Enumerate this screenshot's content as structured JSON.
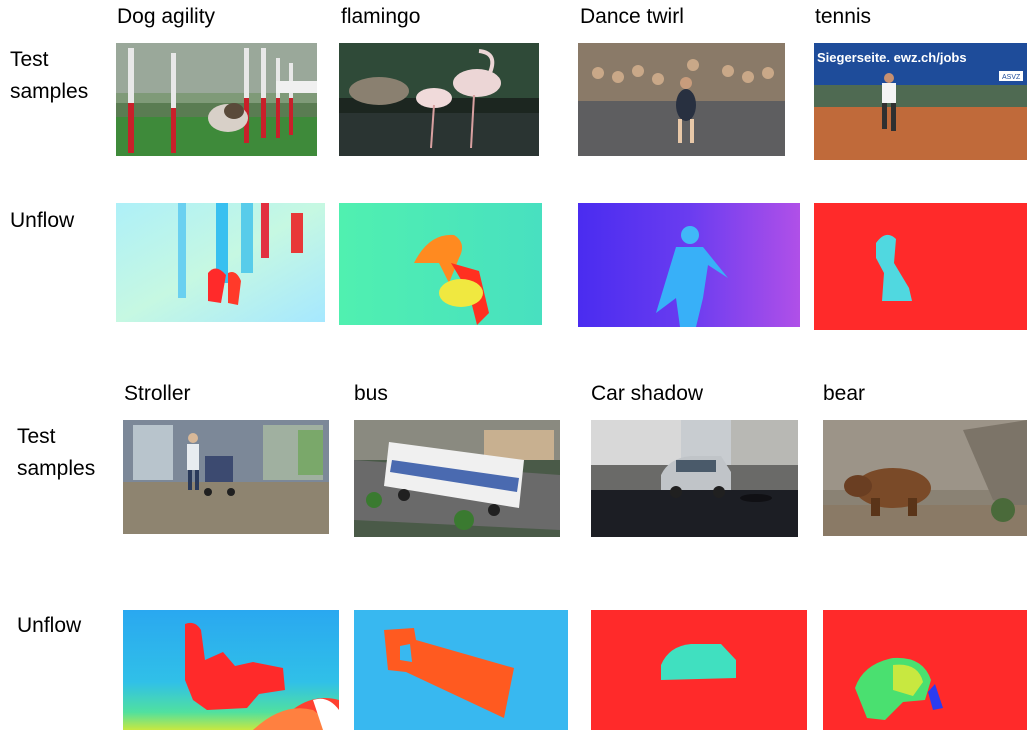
{
  "section1": {
    "titles": [
      "Dog agility",
      "flamingo",
      "Dance twirl",
      "tennis"
    ],
    "row_label_test": [
      "Test",
      "samples"
    ],
    "row_label_flow": "Unflow",
    "overlay_text": {
      "tennis_banner": "Siegerseite. ewz.ch/jobs",
      "tennis_badge": "ASVZ"
    }
  },
  "section2": {
    "titles": [
      "Stroller",
      "bus",
      "Car shadow",
      "bear"
    ],
    "row_label_test": [
      "Test",
      "samples"
    ],
    "row_label_flow": "Unflow"
  },
  "colors": {
    "flow_red": "#ff2a2a",
    "flow_blue": "#30b4f0",
    "flow_cyan": "#4df0c8",
    "flow_purple": "#7a3cf0"
  }
}
